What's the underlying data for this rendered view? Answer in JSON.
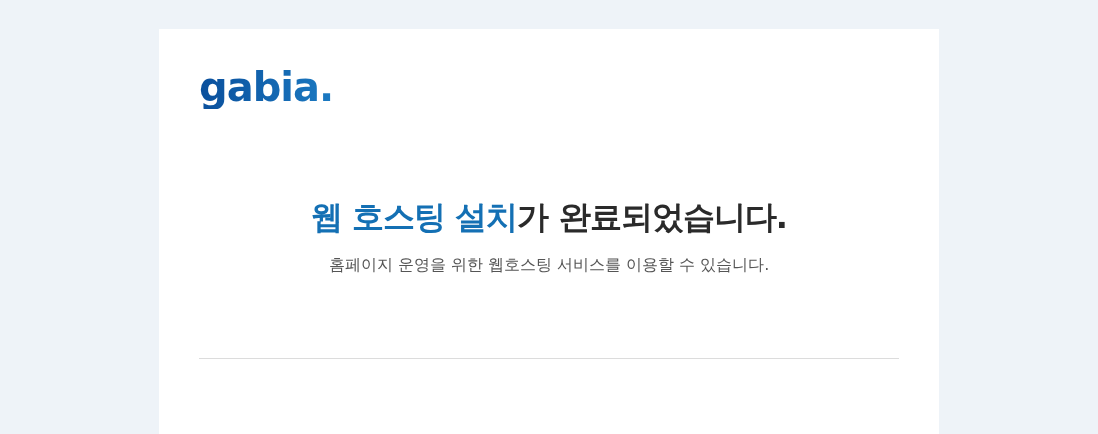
{
  "logo": {
    "text": "gabia."
  },
  "heading": {
    "highlight": "웹 호스팅 설치",
    "rest": "가 완료되었습니다."
  },
  "subtitle": "홈페이지 운영을 위한 웹호스팅 서비스를 이용할 수 있습니다."
}
